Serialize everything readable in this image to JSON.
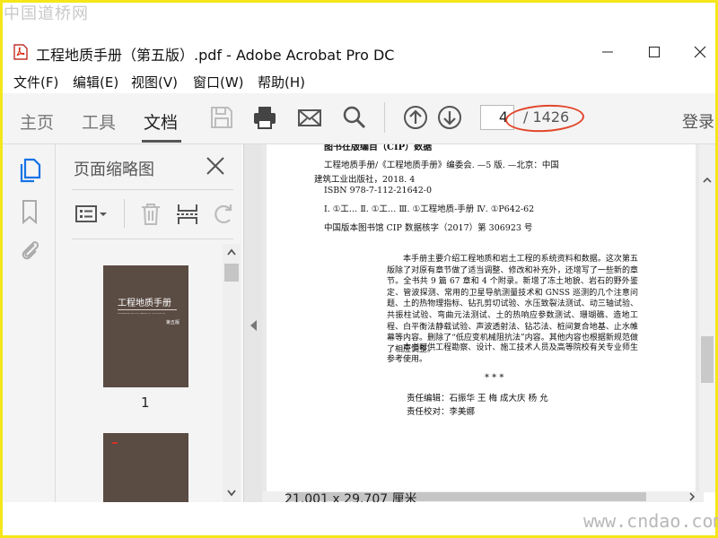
{
  "watermark": {
    "top": "中国道桥网",
    "bottom": "www.cndao.com"
  },
  "window": {
    "title": "工程地质手册（第五版）.pdf - Adobe Acrobat Pro DC"
  },
  "menu": [
    {
      "label": "文件(F)"
    },
    {
      "label": "编辑(E)"
    },
    {
      "label": "视图(V)"
    },
    {
      "label": "窗口(W)"
    },
    {
      "label": "帮助(H)"
    }
  ],
  "toolbar": {
    "tabs": [
      {
        "label": "主页"
      },
      {
        "label": "工具"
      },
      {
        "label": "文档"
      }
    ],
    "active_tab": "文档",
    "icons": [
      "save-icon",
      "print-icon",
      "mail-icon",
      "search-icon",
      "page-up-icon",
      "page-down-icon"
    ],
    "page_current": "4",
    "page_total": "/ 1426",
    "login": "登录"
  },
  "rail_icons": [
    "page-thumbnails-icon",
    "bookmark-icon",
    "attachment-icon"
  ],
  "thumb_panel": {
    "title": "页面缩略图",
    "thumb1_title": "工程地质手册",
    "thumb1_subtitle": "ENGINEERING GEOLOGY HANDBOOK · FIFTH EDITION",
    "thumb1_edition": "第五版",
    "thumb1_label": "1"
  },
  "document": {
    "heading": "图书在版编目（CIP）数据",
    "cip_lines": [
      "工程地质手册/《工程地质手册》编委会. —5 版. —北京：中国",
      "建筑工业出版社，2018. 4",
      "ISBN 978-7-112-21642-0",
      "Ⅰ. ①工…  Ⅱ. ①工…  Ⅲ. ①工程地质-手册  Ⅳ. ①P642-62",
      "中国版本图书馆 CIP 数据核字（2017）第 306923 号"
    ],
    "paragraph": "本手册主要介绍工程地质和岩土工程的系统资料和数据。这次第五版除了对原有章节做了适当调整、修改和补充外，还增写了一些新的章节。全书共 9 篇 67 章和 4 个附录。新增了冻土地貌、岩石的野外鉴定、管波探测、常用的卫星导航测量技术和 GNSS 巡测的几个注意问题、土的热物理指标、钻孔剪切试验、水压致裂法测试、动三轴试验、共振柱试验、弯曲元法测试、土的热响应参数测试、珊瑚礁、造地工程、白平衡法静载试验、声波透射法、钻芯法、桩间复合地基、止水帷幕等内容。删除了“低应变机械阻抗法”内容。其他内容也根据新规范做了相应调整。",
    "paragraph2": "本书可供工程勘察、设计、施工技术人员及高等院校有关专业师生参考使用。",
    "stars": "*      *      *",
    "editor": "责任编辑：石振华   王   梅   成大庆   杨   允",
    "proofreader": "责任校对：李美娜"
  },
  "status": {
    "page_size": "21.001 x 29.707 厘米"
  },
  "colors": {
    "annotation_red": "#e2462a",
    "cover_brown": "#5a4b43",
    "acrobat_blue": "#1473e6"
  }
}
